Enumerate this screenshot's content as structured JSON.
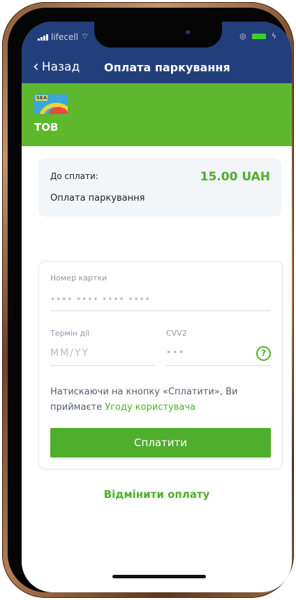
{
  "status_bar": {
    "carrier": "lifecell"
  },
  "nav": {
    "back_label": "Назад",
    "title": "Оплата паркування"
  },
  "merchant": {
    "name": "ТОВ",
    "logo_text": "SEA"
  },
  "summary": {
    "amount_label": "До сплати:",
    "amount": "15.00 UAH",
    "description": "Оплата паркування"
  },
  "form": {
    "card_number_label": "Номер картки",
    "card_number_placeholder": "•••• •••• •••• ••••",
    "expiry_label": "Термін дії",
    "expiry_placeholder": "MM/YY",
    "cvv_label": "CVV2",
    "cvv_placeholder": "•••",
    "help_icon": "?",
    "terms_text": "Натискаючи на кнопку «Сплатити», Ви приймаєте",
    "terms_link": "Угоду користувача",
    "pay_button": "Сплатити"
  },
  "cancel_label": "Відмінити оплату",
  "colors": {
    "header": "#233f7b",
    "brand_green": "#5db82e",
    "accent_green": "#4fae2b"
  }
}
